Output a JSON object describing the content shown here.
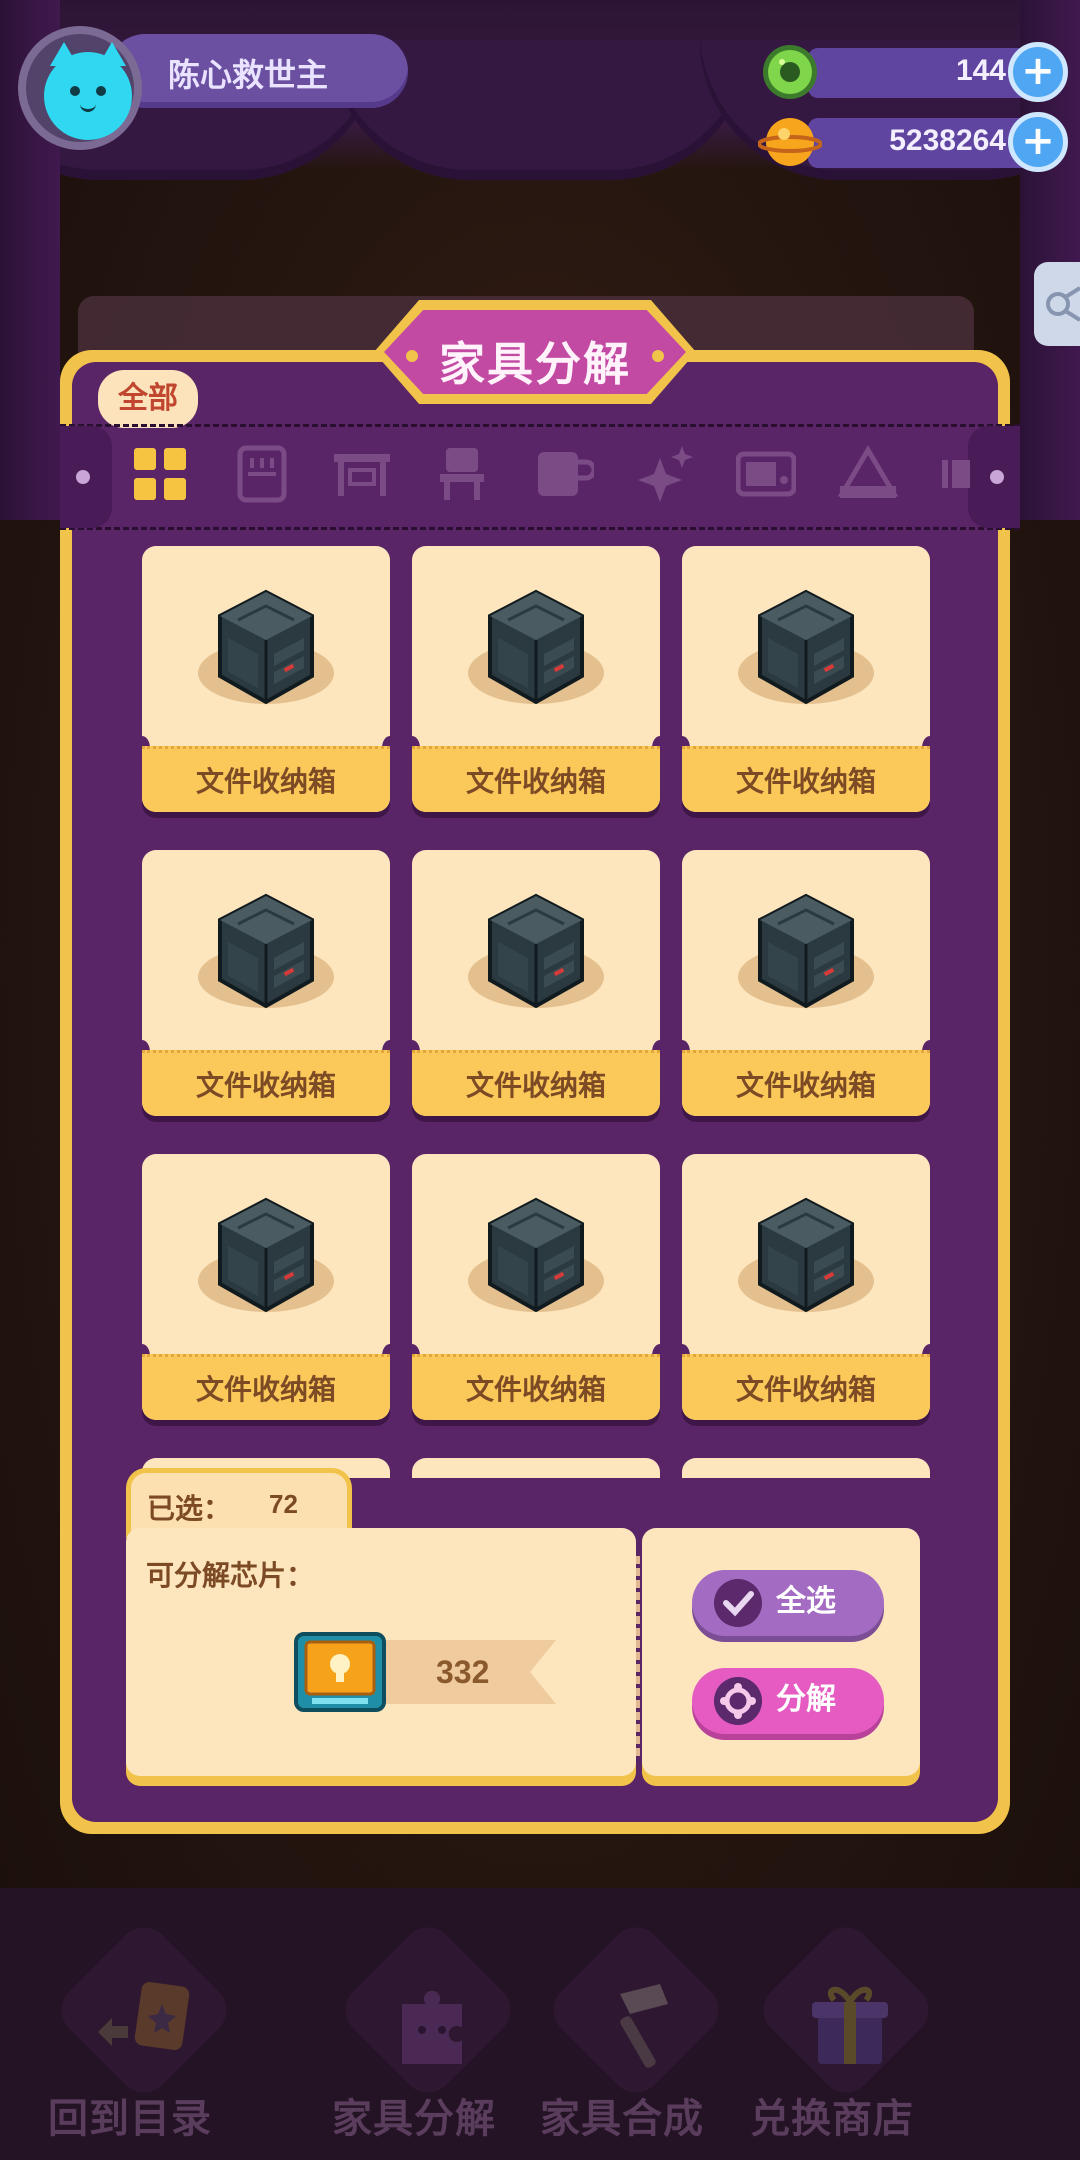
{
  "profile": {
    "name": "陈心救世主"
  },
  "currency": [
    {
      "icon": "green-gem-icon",
      "value": "144"
    },
    {
      "icon": "gold-planet-coin-icon",
      "value": "5238264"
    }
  ],
  "panel": {
    "title": "家具分解",
    "filter_bubble": "全部",
    "categories": [
      "all-grid-icon",
      "cabinet-icon",
      "table-icon",
      "chair-icon",
      "cup-icon",
      "sparkle-icon",
      "tv-icon",
      "tent-icon",
      "more-icon"
    ],
    "items": [
      {
        "label": "文件收纳箱"
      },
      {
        "label": "文件收纳箱"
      },
      {
        "label": "文件收纳箱"
      },
      {
        "label": "文件收纳箱"
      },
      {
        "label": "文件收纳箱"
      },
      {
        "label": "文件收纳箱"
      },
      {
        "label": "文件收纳箱"
      },
      {
        "label": "文件收纳箱"
      },
      {
        "label": "文件收纳箱"
      }
    ]
  },
  "selection": {
    "selected_label": "已选：",
    "selected_count": "72",
    "chip_label": "可分解芯片：",
    "chip_count": "332",
    "select_all": "全选",
    "decompose": "分解"
  },
  "nav": [
    {
      "label": "回到目录",
      "icon": "back-to-catalog-icon"
    },
    {
      "label": "家具分解",
      "icon": "furniture-decompose-icon"
    },
    {
      "label": "家具合成",
      "icon": "furniture-craft-icon"
    },
    {
      "label": "兑换商店",
      "icon": "exchange-shop-icon"
    }
  ],
  "colors": {
    "panel_border": "#f2c34a",
    "panel_bg": "#5a2566",
    "card_bg": "#fde5bd",
    "title_badge": "#c24aa2",
    "button_select_all": "#a46bc2",
    "button_decompose": "#e55bc1"
  }
}
